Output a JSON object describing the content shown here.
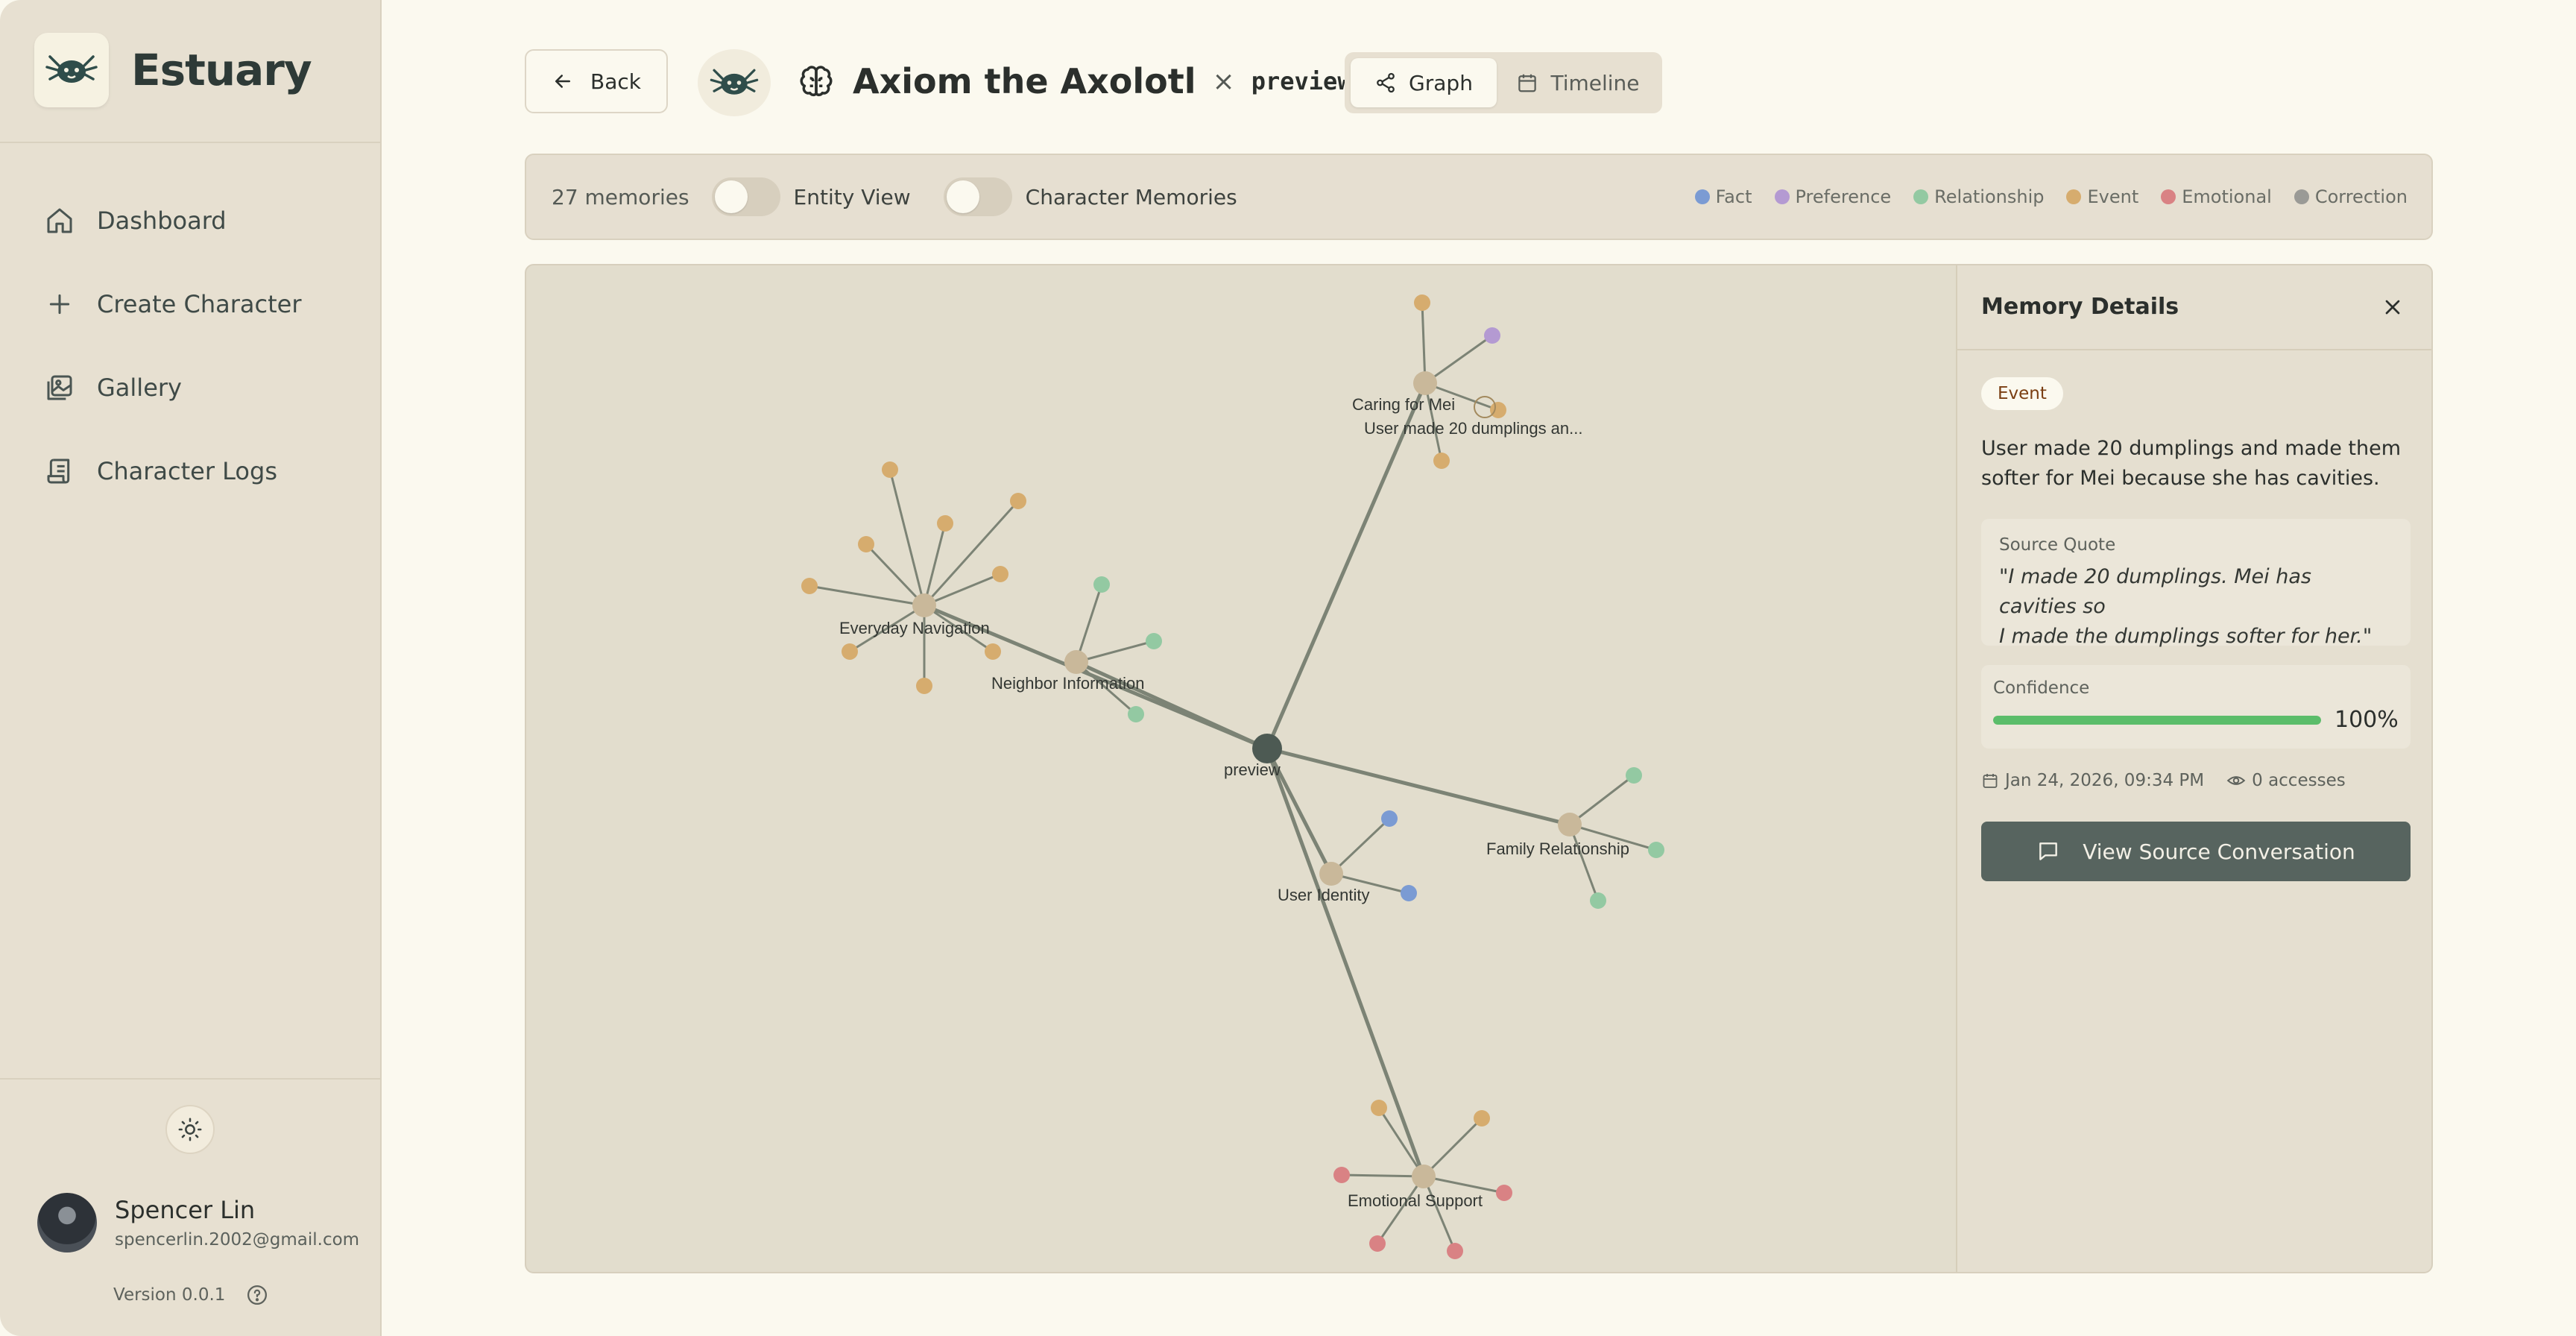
{
  "app": {
    "name": "Estuary"
  },
  "sidebar": {
    "items": [
      {
        "label": "Dashboard",
        "icon": "home-icon"
      },
      {
        "label": "Create Character",
        "icon": "plus-icon"
      },
      {
        "label": "Gallery",
        "icon": "gallery-icon"
      },
      {
        "label": "Character Logs",
        "icon": "logs-icon"
      }
    ],
    "theme_icon": "sun-icon"
  },
  "user": {
    "name": "Spencer Lin",
    "email": "spencerlin.2002@gmail.com"
  },
  "version": "Version 0.0.1",
  "header": {
    "back_label": "Back",
    "title": "Axiom the Axolotl",
    "separator": "×",
    "subtitle": "preview",
    "views": [
      {
        "label": "Graph",
        "icon": "share-icon",
        "active": true
      },
      {
        "label": "Timeline",
        "icon": "calendar-icon",
        "active": false
      }
    ]
  },
  "filter_bar": {
    "count": "27 memories",
    "toggles": [
      {
        "label": "Entity View",
        "on": false
      },
      {
        "label": "Character Memories",
        "on": false
      }
    ],
    "legend": [
      {
        "label": "Fact",
        "color": "#7b9bd3"
      },
      {
        "label": "Preference",
        "color": "#b49ad2"
      },
      {
        "label": "Relationship",
        "color": "#93c9a2"
      },
      {
        "label": "Event",
        "color": "#d6ac6e"
      },
      {
        "label": "Emotional",
        "color": "#d98284"
      },
      {
        "label": "Correction",
        "color": "#9a9a96"
      }
    ]
  },
  "graph": {
    "root_label": "preview",
    "clusters": [
      "Caring for Mei",
      "Everyday Navigation",
      "Neighbor Information",
      "Family Relationship",
      "User Identity",
      "Emotional Support"
    ],
    "highlight_label": "User made 20 dumplings an..."
  },
  "details": {
    "title": "Memory Details",
    "type": "Event",
    "description": "User made 20 dumplings and made them softer for Mei because she has cavities.",
    "quote_label": "Source Quote",
    "quote_line1": "\"I made 20 dumplings. Mei has cavities so",
    "quote_line2": "I made the dumplings softer for her.\"",
    "confidence_label": "Confidence",
    "confidence": 1.0,
    "confidence_text": "100%",
    "date": "Jan 24, 2026, 09:34 PM",
    "accesses": "0 accesses",
    "button_label": "View Source Conversation"
  }
}
